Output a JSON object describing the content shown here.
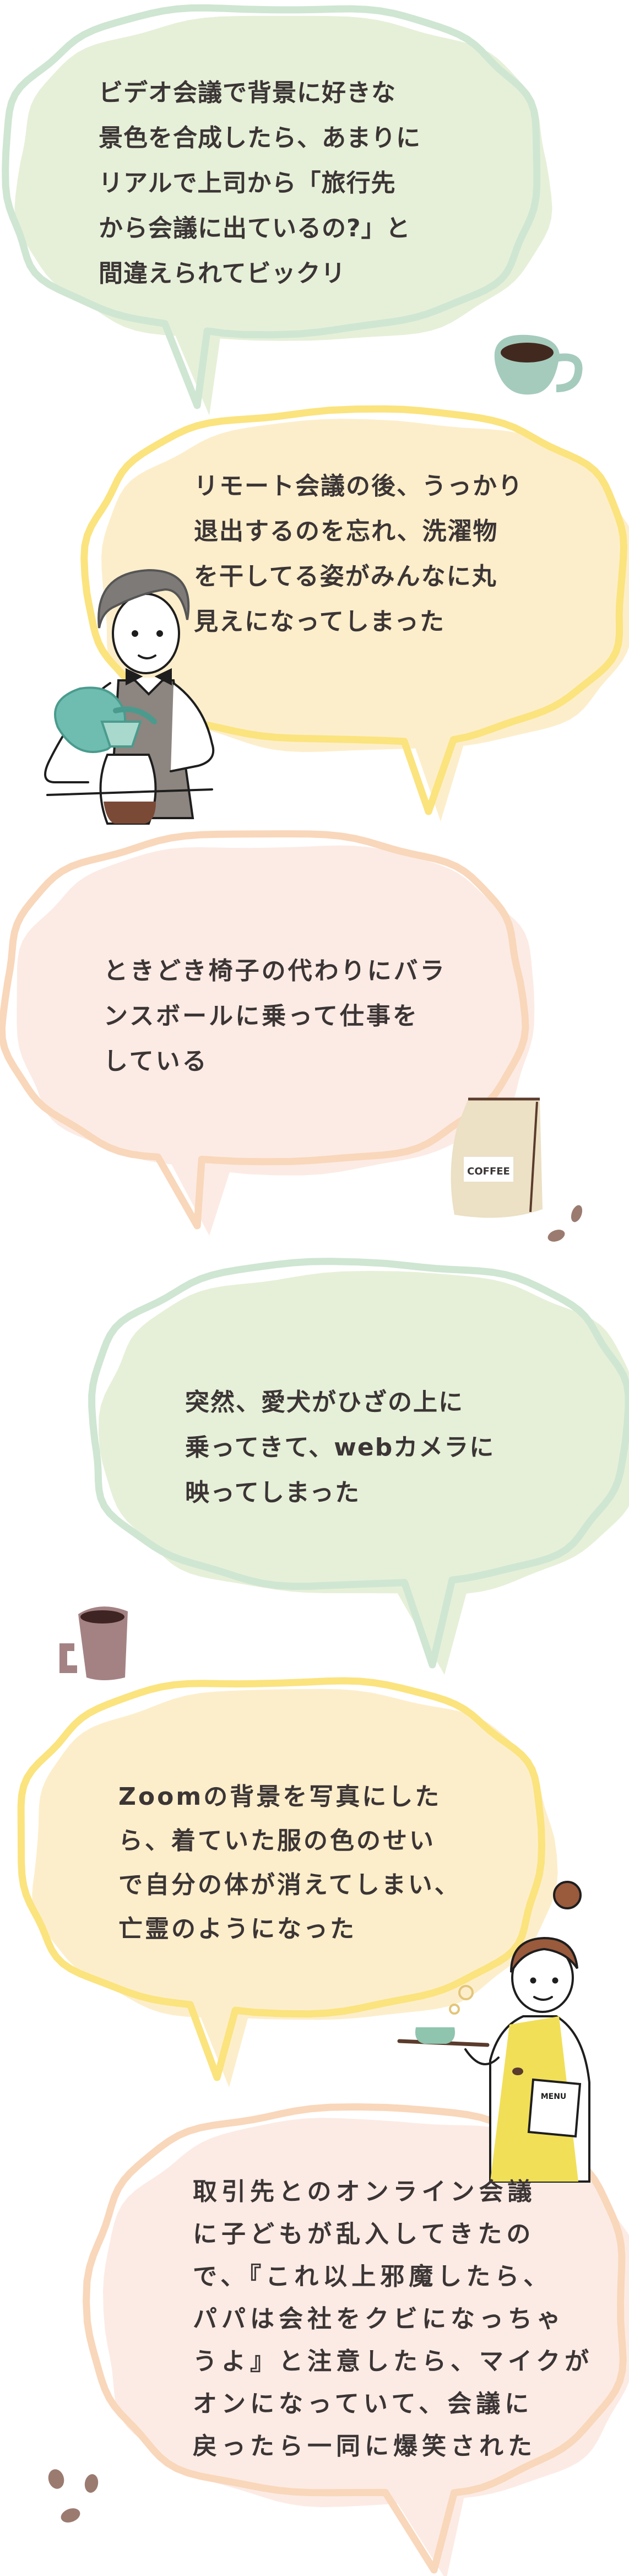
{
  "colors": {
    "text": "#3b3535",
    "green_fill": "#e6f0d8",
    "green_stroke": "#cfe6d2",
    "yellow_fill": "#fdeecb",
    "yellow_stroke": "#fbe37e",
    "peach_fill": "#fcebe4",
    "peach_stroke": "#f9d7bb"
  },
  "bubbles": [
    {
      "theme": "green",
      "lines": [
        "ビデオ会議で背景に好きな",
        "景色を合成したら、あまりに",
        "リアルで上司から「旅行先",
        "から会議に出ているの?」と",
        "間違えられてビックリ"
      ]
    },
    {
      "theme": "yellow",
      "lines": [
        "リモート会議の後、うっかり",
        "退出するのを忘れ、洗濯物",
        "を干してる姿がみんなに丸",
        "見えになってしまった"
      ]
    },
    {
      "theme": "peach",
      "lines": [
        "ときどき椅子の代わりにバラ",
        "ンスボールに乗って仕事を",
        "している"
      ]
    },
    {
      "theme": "green",
      "lines": [
        "突然、愛犬がひざの上に",
        "乗ってきて、webカメラに",
        "映ってしまった"
      ]
    },
    {
      "theme": "yellow",
      "lines": [
        "Zoomの背景を写真にした",
        "ら、着ていた服の色のせい",
        "で自分の体が消えてしまい、",
        "亡霊のようになった"
      ]
    },
    {
      "theme": "peach",
      "lines": [
        "取引先とのオンライン会議",
        "に子どもが乱入してきたの",
        "で、『これ以上邪魔したら、",
        "パパは会社をクビになっちゃ",
        "うよ』と注意したら、マイクが",
        "オンになっていて、会議に",
        "戻ったら一同に爆笑された"
      ]
    }
  ],
  "illustrations": {
    "coffee_bag_label": "COFFEE",
    "menu_label": "MENU",
    "icons": [
      "teal-coffee-cup",
      "barista-pouring-coffee",
      "coffee-bag",
      "coffee-beans",
      "mauve-mug",
      "waitress-with-tray",
      "coffee-beans"
    ]
  }
}
